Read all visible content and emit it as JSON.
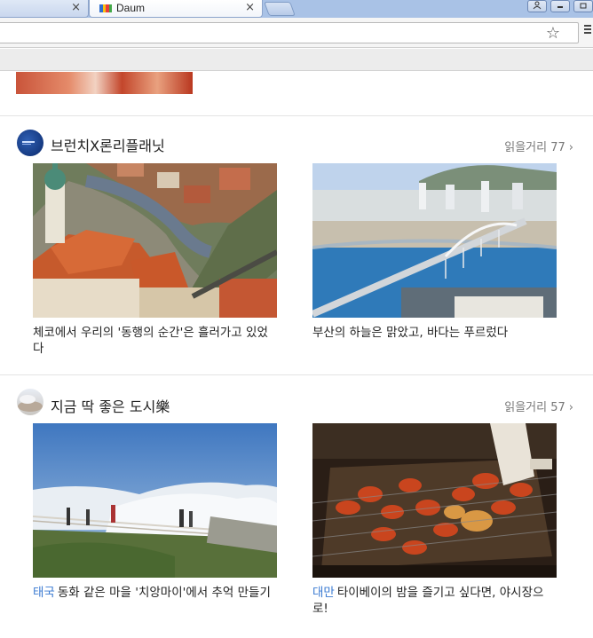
{
  "browser": {
    "active_tab_title": "Daum",
    "close_glyph": "×",
    "favicon_colors": [
      "#2f6fd0",
      "#f7c212",
      "#e93c3c",
      "#42a948"
    ]
  },
  "sections": [
    {
      "title": "브런치X론리플래닛",
      "read_more_label": "읽을거리",
      "read_more_count": "77",
      "cards": [
        {
          "category": "",
          "caption": "체코에서 우리의 '동행의 순간'은 흘러가고 있었다"
        },
        {
          "category": "",
          "caption": "부산의 하늘은 맑았고, 바다는 푸르렀다"
        }
      ]
    },
    {
      "title": "지금 딱 좋은 도시樂",
      "read_more_label": "읽을거리",
      "read_more_count": "57",
      "cards": [
        {
          "category": "태국",
          "caption": "동화 같은 마을 '치앙마이'에서 추억 만들기"
        },
        {
          "category": "대만",
          "caption": "타이베이의 밤을 즐기고 싶다면, 야시장으로!"
        }
      ]
    }
  ],
  "icons": {
    "star": "☆",
    "chevron": "›"
  },
  "colors": {
    "category_link": "#3b7bd2",
    "tab_strip": "#a9c2e6"
  }
}
